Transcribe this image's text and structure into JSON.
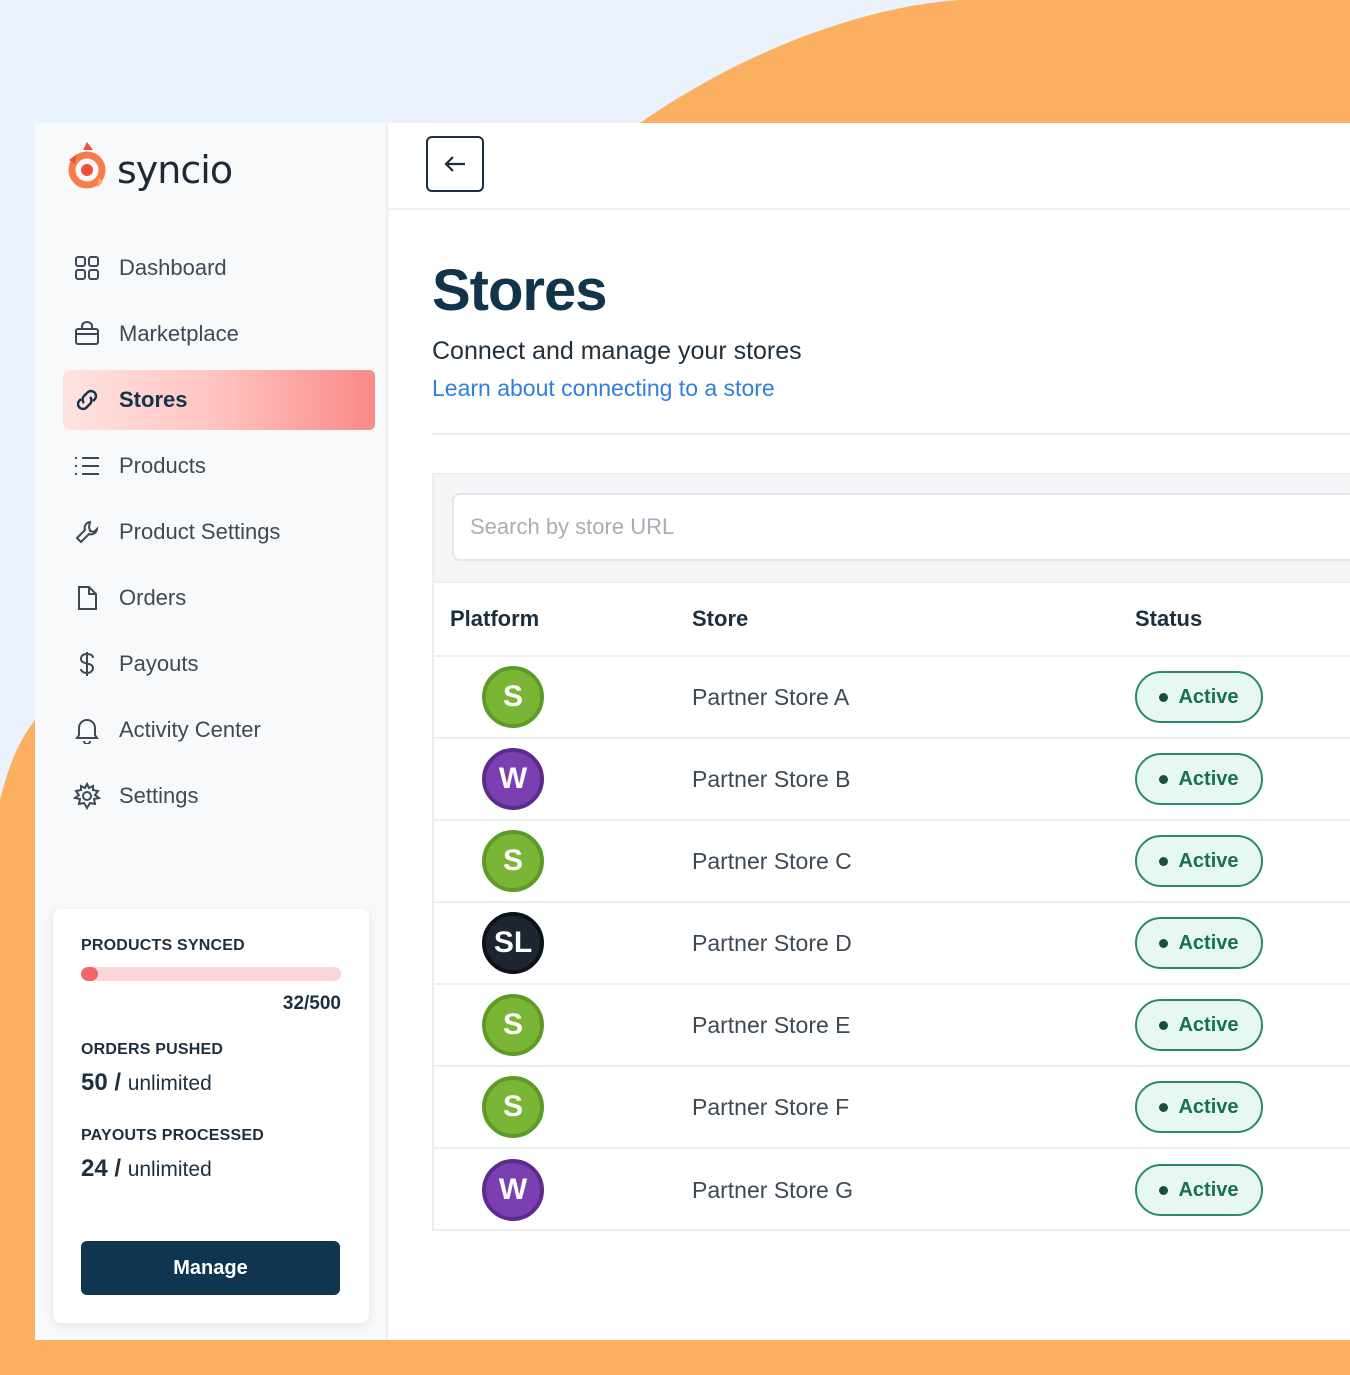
{
  "brand": {
    "name": "syncio"
  },
  "colors": {
    "accent_orange": "#fbb061",
    "primary_navy": "#0f3550",
    "link_blue": "#2f7fe0",
    "active_green": "#2a8a66",
    "shopify_green": "#7ab536",
    "woo_purple": "#7a3fb0",
    "sl_dark": "#1c2530"
  },
  "sidebar": {
    "items": [
      {
        "label": "Dashboard",
        "icon": "grid-icon"
      },
      {
        "label": "Marketplace",
        "icon": "shopping-bag-icon"
      },
      {
        "label": "Stores",
        "icon": "link-icon",
        "active": true
      },
      {
        "label": "Products",
        "icon": "list-icon"
      },
      {
        "label": "Product Settings",
        "icon": "wrench-icon"
      },
      {
        "label": "Orders",
        "icon": "document-icon"
      },
      {
        "label": "Payouts",
        "icon": "dollar-icon"
      },
      {
        "label": "Activity Center",
        "icon": "bell-icon"
      },
      {
        "label": "Settings",
        "icon": "gear-icon"
      }
    ],
    "stats": {
      "products_synced_label": "PRODUCTS SYNCED",
      "products_synced_value": "32/500",
      "products_synced_fraction": 0.064,
      "orders_pushed_label": "ORDERS PUSHED",
      "orders_pushed_count": "50 /",
      "orders_pushed_limit": "unlimited",
      "payouts_processed_label": "PAYOUTS PROCESSED",
      "payouts_processed_count": "24 /",
      "payouts_processed_limit": "unlimited",
      "manage_label": "Manage"
    }
  },
  "main": {
    "title": "Stores",
    "subtitle": "Connect and manage your stores",
    "link": "Learn about connecting to a store",
    "search_placeholder": "Search by store URL",
    "table": {
      "headers": {
        "platform": "Platform",
        "store": "Store",
        "status": "Status"
      },
      "rows": [
        {
          "platform": "S",
          "platform_type": "shopify",
          "store": "Partner Store A",
          "status": "Active"
        },
        {
          "platform": "W",
          "platform_type": "woocommerce",
          "store": "Partner Store B",
          "status": "Active"
        },
        {
          "platform": "S",
          "platform_type": "shopify",
          "store": "Partner Store C",
          "status": "Active"
        },
        {
          "platform": "SL",
          "platform_type": "sl",
          "store": "Partner Store D",
          "status": "Active"
        },
        {
          "platform": "S",
          "platform_type": "shopify",
          "store": "Partner Store E",
          "status": "Active"
        },
        {
          "platform": "S",
          "platform_type": "shopify",
          "store": "Partner Store F",
          "status": "Active"
        },
        {
          "platform": "W",
          "platform_type": "woocommerce",
          "store": "Partner Store G",
          "status": "Active"
        }
      ]
    }
  }
}
